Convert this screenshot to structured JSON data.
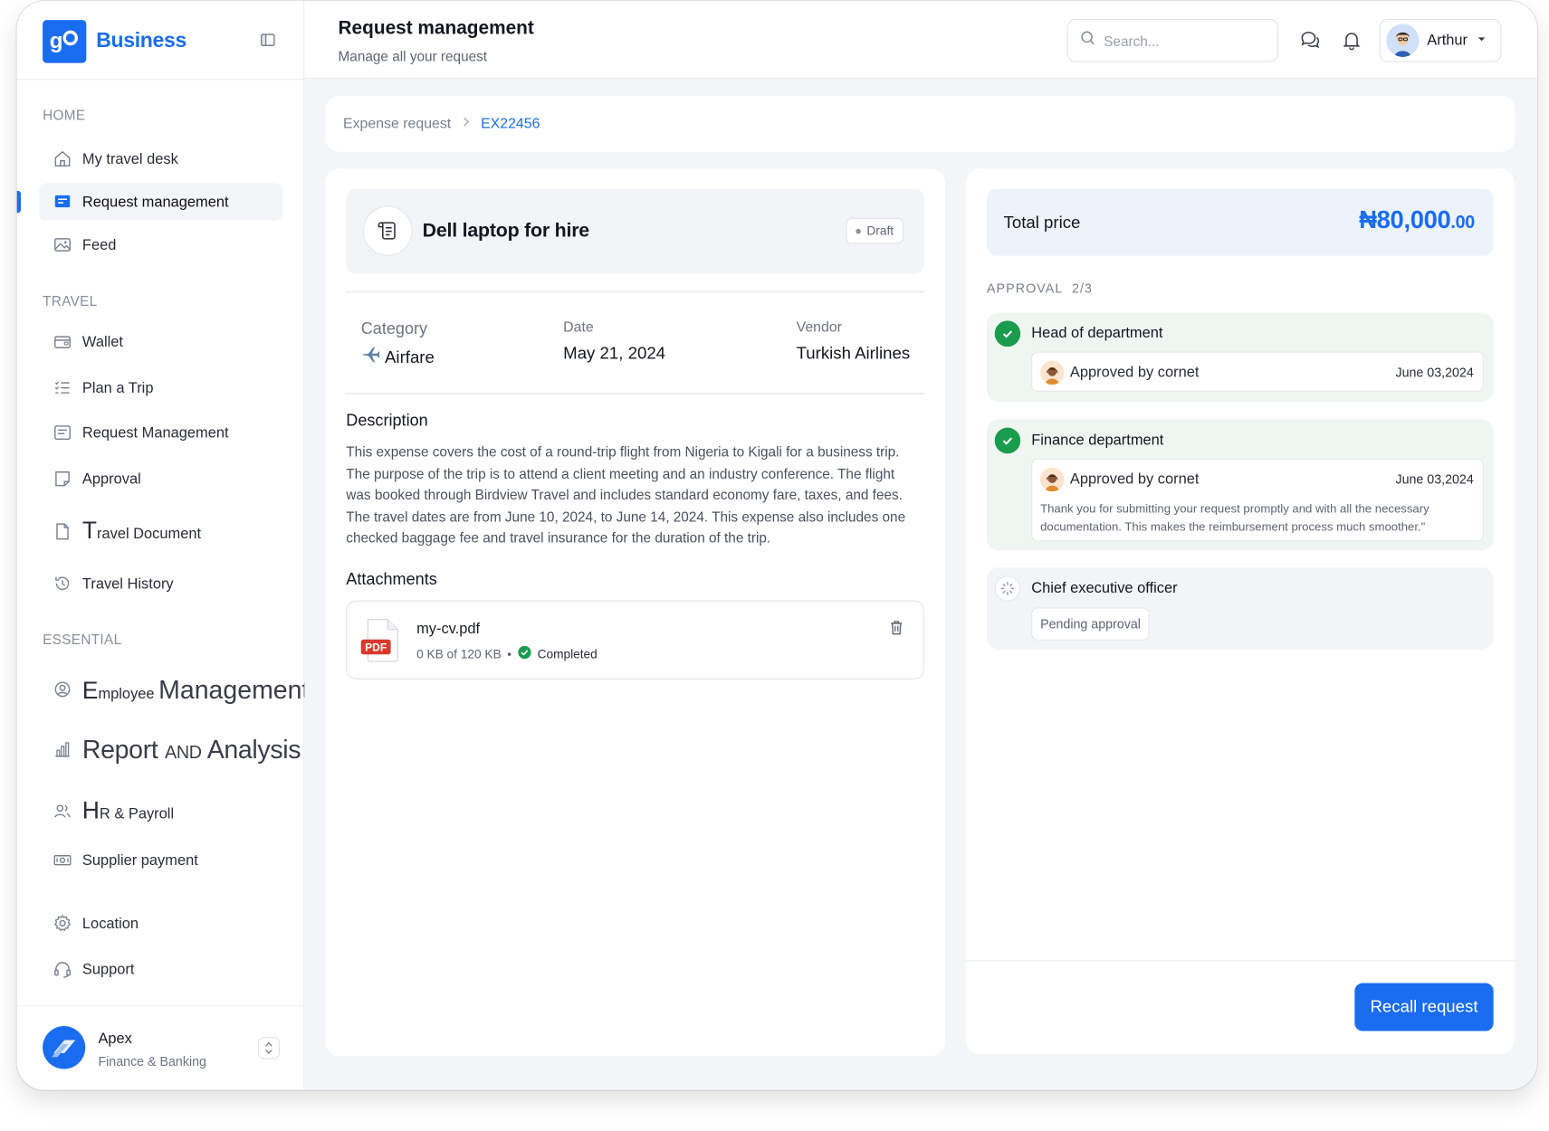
{
  "brand": {
    "name": "Business",
    "logo_text": "go"
  },
  "sidebar": {
    "sections": {
      "home": "HOME",
      "travel": "TRAVEL",
      "essential": "ESSENTIAL"
    },
    "items": {
      "my_travel_desk": "My travel desk",
      "request_management": "Request management",
      "feed": "Feed",
      "wallet": "Wallet",
      "plan_a_trip": "Plan a Trip",
      "request_management_2": "Request Management",
      "approval": "Approval",
      "travel_document_cap": "T",
      "travel_document_rest": "ravel Document",
      "travel_history": "Travel History",
      "employee_cap": "E",
      "employee_rest": "mployee",
      "employee_word": "Management",
      "report_a": "Report",
      "report_b": "and",
      "report_c": "Analysis",
      "hr_cap": "H",
      "hr_rest": "R & Payroll",
      "supplier_payment": "Supplier payment",
      "location": "Location",
      "support": "Support"
    },
    "org": {
      "name": "Apex",
      "subtitle": "Finance & Banking"
    }
  },
  "header": {
    "title": "Request management",
    "subtitle": "Manage all your request",
    "search_placeholder": "Search...",
    "user_name": "Arthur"
  },
  "breadcrumb": {
    "parent": "Expense request",
    "current": "EX22456"
  },
  "request": {
    "title": "Dell laptop for hire",
    "status": "Draft",
    "category_label": "Category",
    "category_value": "Airfare",
    "date_label": "Date",
    "date_value": "May 21, 2024",
    "vendor_label": "Vendor",
    "vendor_value": "Turkish Airlines",
    "description_title": "Description",
    "description": "This expense covers the cost of a round-trip flight from Nigeria to Kigali for a business trip. The purpose of the trip is to attend a client meeting and an industry conference. The flight was booked through Birdview Travel and includes standard economy fare, taxes, and fees. The travel dates are from June 10, 2024, to June 14, 2024. This expense also includes one checked baggage fee and travel insurance for the duration of the trip.",
    "attachments_title": "Attachments",
    "attachment": {
      "file_name": "my-cv.pdf",
      "size_text": "0 KB of 120 KB",
      "status": "Completed",
      "type_label": "PDF"
    }
  },
  "summary": {
    "total_label": "Total price",
    "total_main": "₦80,000",
    "total_decimal": ".00",
    "approval_label": "APPROVAL  2/3",
    "steps": [
      {
        "title": "Head of department",
        "approver": "Approved by cornet",
        "date": "June 03,2024"
      },
      {
        "title": "Finance department",
        "approver": "Approved by cornet",
        "date": "June 03,2024",
        "note": "Thank you for submitting your request promptly and with all the necessary documentation. This makes the reimbursement process much smoother.\""
      },
      {
        "title": "Chief executive officer",
        "status": "Pending approval"
      }
    ],
    "recall_button": "Recall request"
  },
  "colors": {
    "accent": "#1a6cf0",
    "success": "#1a9c4e",
    "pdf_red": "#d83a2f"
  }
}
